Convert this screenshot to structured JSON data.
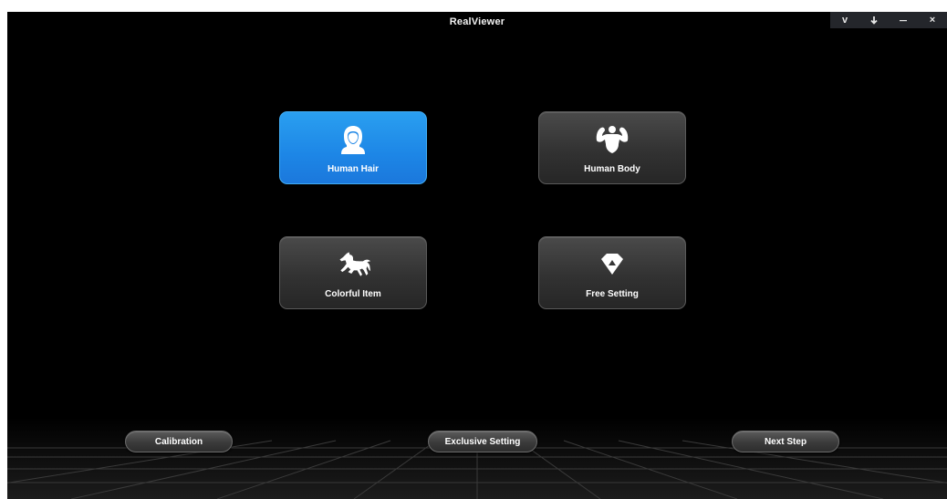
{
  "window": {
    "title": "RealViewer"
  },
  "window_controls": [
    {
      "name": "v-button",
      "label": "v"
    },
    {
      "name": "download-icon",
      "label": ""
    },
    {
      "name": "minimize-icon",
      "label": ""
    },
    {
      "name": "close-icon",
      "label": "×"
    }
  ],
  "modes": [
    {
      "label": "Human Hair",
      "icon": "woman-portrait-icon",
      "selected": true
    },
    {
      "label": "Human Body",
      "icon": "flexing-muscle-icon",
      "selected": false
    },
    {
      "label": "Colorful Item",
      "icon": "horse-icon",
      "selected": false
    },
    {
      "label": "Free Setting",
      "icon": "diamond-icon",
      "selected": false
    }
  ],
  "footer": {
    "calibration_label": "Calibration",
    "exclusive_label": "Exclusive Setting",
    "next_label": "Next Step"
  },
  "colors": {
    "background": "#000000",
    "selected_tile": "#1d86e6",
    "tile": "#363636"
  }
}
